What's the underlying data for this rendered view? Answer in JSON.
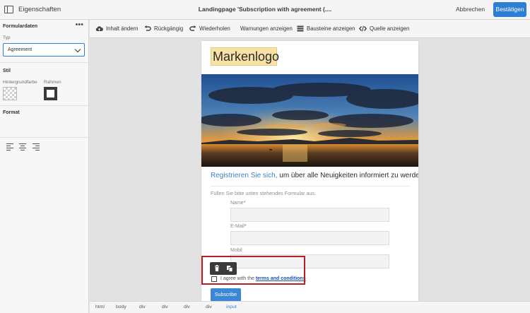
{
  "header": {
    "panel_title": "Eigenschaften",
    "document_title": "Landingpage 'Subscription with agreement (....",
    "cancel_label": "Abbrechen",
    "confirm_label": "Bestätigen"
  },
  "left_panel": {
    "form_data": {
      "heading": "Formulardaten",
      "type_label": "Typ",
      "type_value": "Agreement"
    },
    "style": {
      "heading": "Stil",
      "background_label": "Hintergrundfarbe",
      "border_label": "Rahmen"
    },
    "format": {
      "heading": "Format",
      "align_icons": [
        "align-left-icon",
        "align-center-icon",
        "align-right-icon"
      ]
    }
  },
  "toolbar": {
    "items": [
      {
        "label": "Inhalt ändern",
        "icon": "cloud-upload-icon"
      },
      {
        "label": "Rückgängig",
        "icon": "undo-icon"
      },
      {
        "label": "Wiederholen",
        "icon": "redo-icon"
      },
      {
        "label": "Warnungen anzeigen",
        "icon": ""
      },
      {
        "label": "Bausteine anzeigen",
        "icon": "blocks-icon"
      },
      {
        "label": "Quelle anzeigen",
        "icon": "code-icon"
      }
    ]
  },
  "page": {
    "logo_text": "Markenlogo",
    "headline_link": "Registrieren Sie sich,",
    "headline_rest": " um über alle Neuigkeiten informiert zu werden.",
    "intro": "Füllen Sie bitte unten stehendes Formular aus.",
    "fields": [
      {
        "label": "Name",
        "required": "*"
      },
      {
        "label": "E-Mail",
        "required": "*"
      },
      {
        "label": "Mobil",
        "required": ""
      }
    ],
    "agreement_prefix": "I agree with the ",
    "agreement_link": "terms and conditions",
    "subscribe_label": "Subscribe"
  },
  "breadcrumb": [
    "html",
    "body",
    "div",
    "div",
    "div",
    "div",
    "input"
  ],
  "colors": {
    "accent": "#2d7fd3",
    "selection": "#b3202a",
    "logo_bg": "#f8e2a6"
  }
}
